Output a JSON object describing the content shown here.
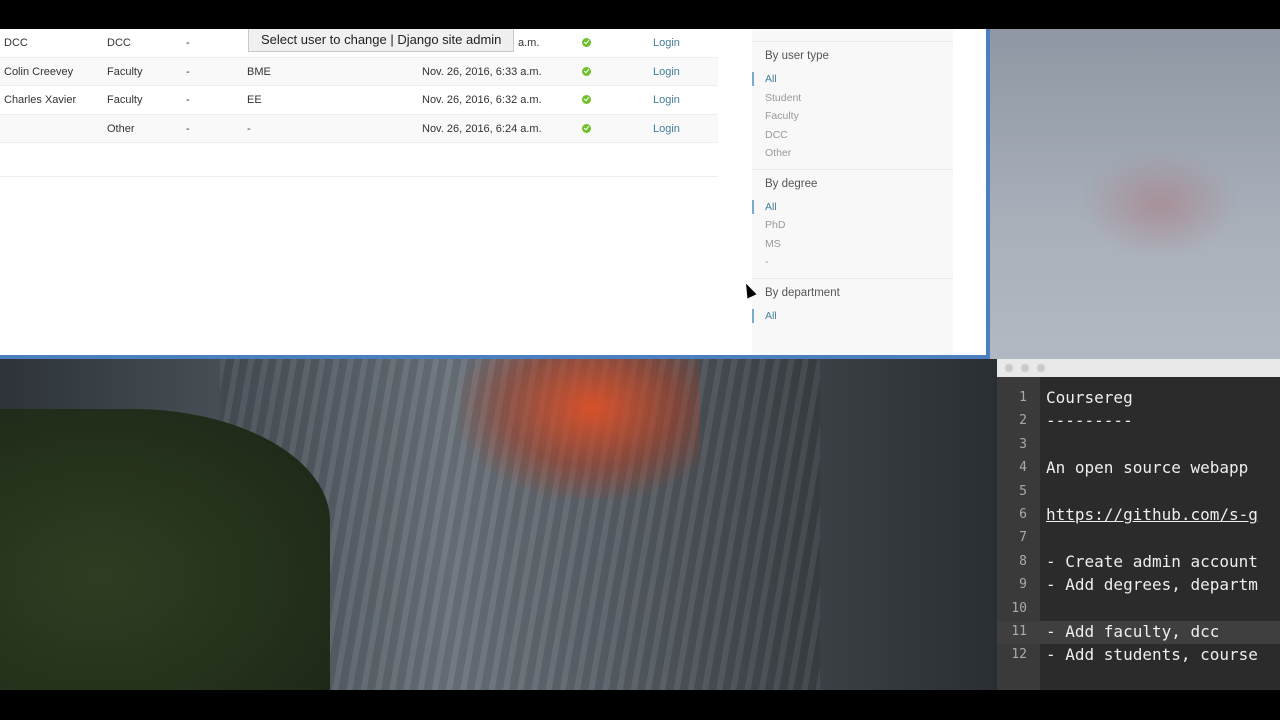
{
  "tooltip": "Select user to change | Django site admin",
  "table": {
    "rows": [
      {
        "name": "DCC",
        "type": "DCC",
        "degree": "-",
        "dept": "",
        "date": "a.m.",
        "login": "Login"
      },
      {
        "name": "Colin Creevey",
        "type": "Faculty",
        "degree": "-",
        "dept": "BME",
        "date": "Nov. 26, 2016, 6:33 a.m.",
        "login": "Login"
      },
      {
        "name": "Charles Xavier",
        "type": "Faculty",
        "degree": "-",
        "dept": "EE",
        "date": "Nov. 26, 2016, 6:32 a.m.",
        "login": "Login"
      },
      {
        "name": "",
        "type": "Other",
        "degree": "-",
        "dept": "-",
        "date": "Nov. 26, 2016, 6:24 a.m.",
        "login": "Login"
      }
    ]
  },
  "filter": {
    "user_type": {
      "title": "By user type",
      "options": [
        "All",
        "Student",
        "Faculty",
        "DCC",
        "Other"
      ]
    },
    "degree": {
      "title": "By degree",
      "options": [
        "All",
        "PhD",
        "MS",
        "-"
      ]
    },
    "department": {
      "title": "By department",
      "options": [
        "All"
      ]
    }
  },
  "editor": {
    "lines": [
      {
        "num": "1",
        "text": "Coursereg"
      },
      {
        "num": "2",
        "text": "---------"
      },
      {
        "num": "3",
        "text": ""
      },
      {
        "num": "4",
        "text": "An open source webapp"
      },
      {
        "num": "5",
        "text": ""
      },
      {
        "num": "6",
        "text": "https://github.com/s-g"
      },
      {
        "num": "7",
        "text": ""
      },
      {
        "num": "8",
        "text": "- Create admin account"
      },
      {
        "num": "9",
        "text": "- Add degrees, departm"
      },
      {
        "num": "10",
        "text": ""
      },
      {
        "num": "11",
        "text": "- Add faculty, dcc"
      },
      {
        "num": "12",
        "text": "- Add students, course"
      }
    ]
  },
  "colors": {
    "accent": "#447e9b",
    "window_border": "#4c7fbf",
    "ok": "#70bf2b"
  }
}
